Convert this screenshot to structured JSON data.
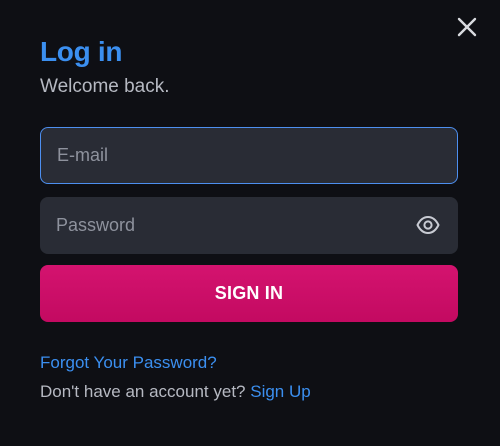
{
  "modal": {
    "title": "Log in",
    "subtitle": "Welcome back."
  },
  "form": {
    "email_placeholder": "E-mail",
    "email_value": "",
    "password_placeholder": "Password",
    "password_value": "",
    "submit_label": "SIGN IN"
  },
  "links": {
    "forgot_password": "Forgot Your Password?",
    "no_account_text": "Don't have an account yet?",
    "signup": "Sign Up"
  },
  "icons": {
    "close": "close-icon",
    "password_toggle": "eye-icon"
  },
  "colors": {
    "background": "#0e0f14",
    "accent": "#3b8ff0",
    "button": "#cc0e68",
    "field": "#292c35"
  }
}
